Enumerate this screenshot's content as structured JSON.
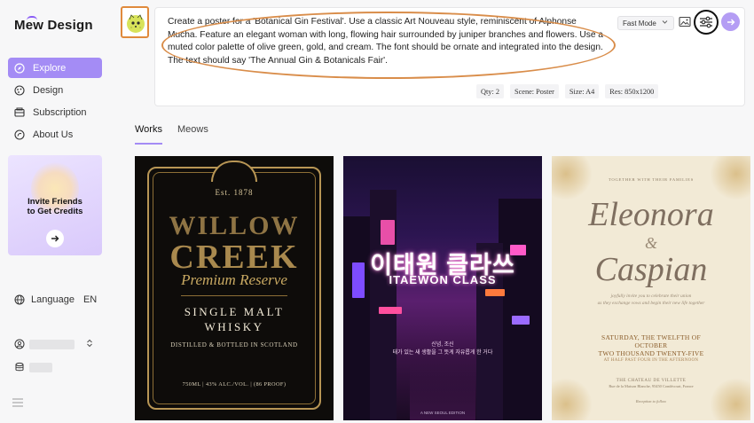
{
  "app": {
    "logo": "Mew Design"
  },
  "sidebar": {
    "items": [
      {
        "label": "Explore",
        "icon": "compass-icon",
        "active": true
      },
      {
        "label": "Design",
        "icon": "palette-icon",
        "active": false
      },
      {
        "label": "Subscription",
        "icon": "card-icon",
        "active": false
      },
      {
        "label": "About Us",
        "icon": "info-icon",
        "active": false
      }
    ],
    "promo": {
      "line1": "Invite Friends",
      "line2": "to Get Credits",
      "button_icon": "arrow-right-icon"
    },
    "language": {
      "label": "Language",
      "code": "EN"
    }
  },
  "prompt": {
    "text": "Create a poster for a 'Botanical Gin Festival'. Use a classic Art Nouveau style, reminiscent of Alphonse Mucha. Feature an elegant woman with long, flowing hair surrounded by juniper branches and flowers. Use a muted color palette of olive green, gold, and cream. The font should be ornate and integrated into the design. The text should say 'The Annual Gin & Botanicals Fair'.",
    "mode": "Fast Mode",
    "chips": [
      "Qty: 2",
      "Scene: Poster",
      "Size: A4",
      "Res: 850x1200"
    ]
  },
  "tabs": [
    {
      "label": "Works",
      "active": true
    },
    {
      "label": "Meows",
      "active": false
    }
  ],
  "cards": {
    "whisky": {
      "est": "Est. 1878",
      "title1": "WILLOW",
      "title2": "CREEK",
      "subtitle": "Premium Reserve",
      "line1": "SINGLE MALT",
      "line2": "WHISKY",
      "distilled": "DISTILLED & BOTTLED IN SCOTLAND",
      "proof": "750ML | 43% ALC./VOL. | (86 PROOF)"
    },
    "itaewon": {
      "korean": "이태원 클라쓰",
      "english": "ITAEWON CLASS",
      "small1": "신념, 조신",
      "small2": "태가 있는 새 생활을 그 뜻게 자유롭게 한 거다",
      "foot": "A NEW SEOUL EDITION"
    },
    "wedding": {
      "top": "TOGETHER WITH THEIR FAMILIES",
      "name1": "Eleonora",
      "amp": "&",
      "name2": "Caspian",
      "invite1": "joyfully invite you to celebrate their union",
      "invite2": "as they exchange vows and begin their new life together",
      "date1": "SATURDAY, THE TWELFTH OF",
      "date2": "OCTOBER",
      "date3": "TWO THOUSAND TWENTY-FIVE",
      "time": "AT HALF PAST FOUR IN THE AFTERNOON",
      "venue": "THE CHATEAU DE VILLETTE",
      "address": "Rue de la Maison Blanche, 95450 Condécourt, France",
      "rsvp": "Reception to follow"
    }
  },
  "colors": {
    "accent": "#a48cf5",
    "highlight_outline": "#d98d4a"
  }
}
